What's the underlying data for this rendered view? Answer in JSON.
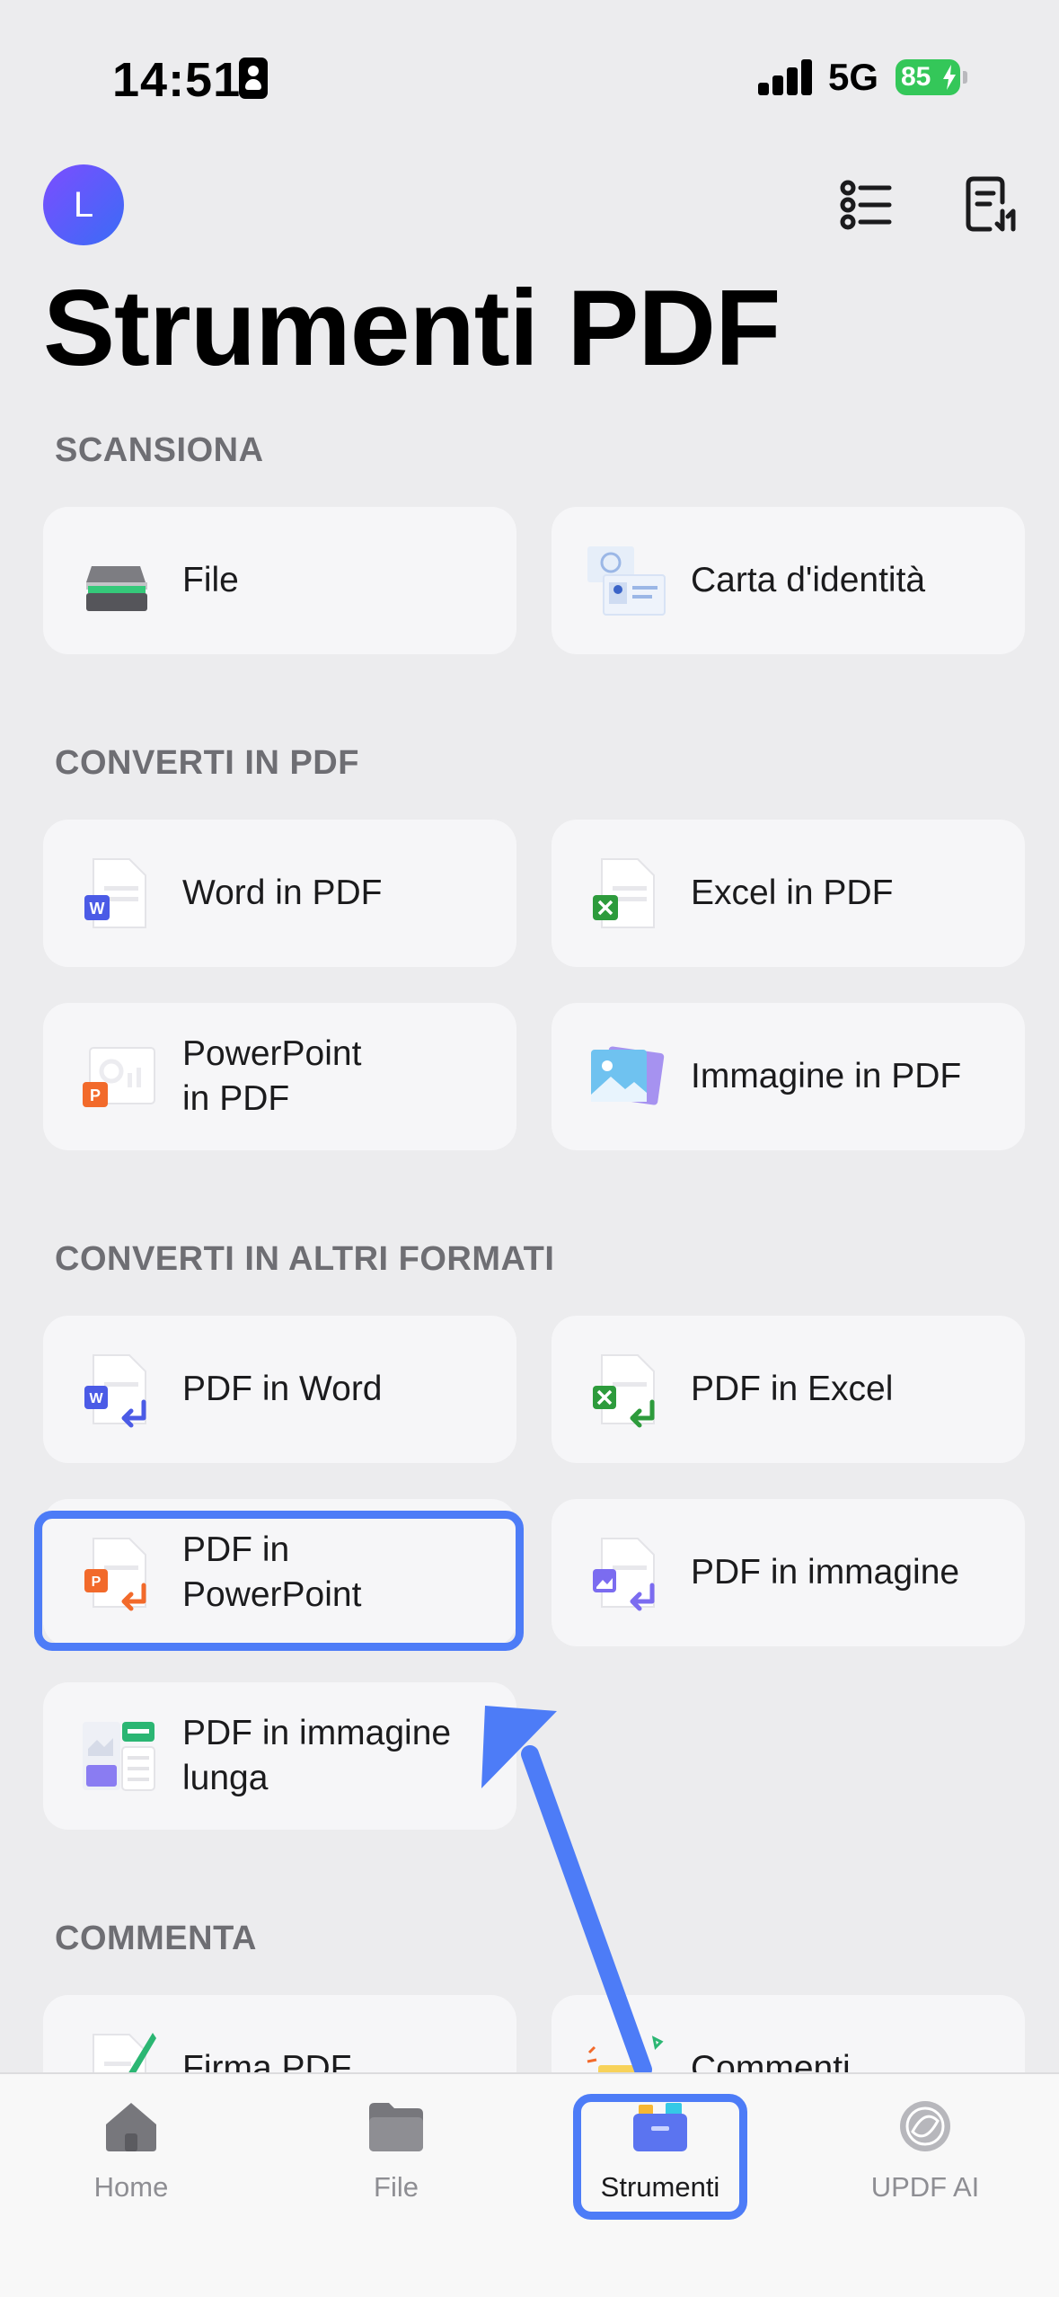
{
  "status_bar": {
    "time": "14:51",
    "network": "5G",
    "battery": "85"
  },
  "header": {
    "avatar_letter": "L",
    "title": "Strumenti PDF"
  },
  "sections": [
    {
      "title": "SCANSIONA",
      "items": [
        {
          "label": "File",
          "icon": "scanner-icon"
        },
        {
          "label": "Carta d'identità",
          "icon": "id-card-icon"
        }
      ]
    },
    {
      "title": "CONVERTI IN PDF",
      "items": [
        {
          "label": "Word in PDF",
          "icon": "word-doc-icon"
        },
        {
          "label": "Excel in PDF",
          "icon": "excel-doc-icon"
        },
        {
          "label": "PowerPoint\nin PDF",
          "icon": "powerpoint-doc-icon"
        },
        {
          "label": "Immagine in PDF",
          "icon": "image-stack-icon"
        }
      ]
    },
    {
      "title": "CONVERTI IN ALTRI FORMATI",
      "items": [
        {
          "label": "PDF in Word",
          "icon": "pdf-to-word-icon"
        },
        {
          "label": "PDF in Excel",
          "icon": "pdf-to-excel-icon"
        },
        {
          "label": "PDF in\nPowerPoint",
          "icon": "pdf-to-powerpoint-icon"
        },
        {
          "label": "PDF in immagine",
          "icon": "pdf-to-image-icon"
        },
        {
          "label": "PDF in immagine\nlunga",
          "icon": "pdf-to-long-image-icon"
        }
      ]
    },
    {
      "title": "COMMENTA",
      "items": [
        {
          "label": "Firma PDF",
          "icon": "signature-pen-icon"
        },
        {
          "label": "Commenti",
          "icon": "sticky-note-icon"
        }
      ]
    }
  ],
  "tabs": [
    {
      "label": "Home",
      "icon": "home-icon",
      "active": false
    },
    {
      "label": "File",
      "icon": "folder-icon",
      "active": false
    },
    {
      "label": "Strumenti",
      "icon": "toolbox-icon",
      "active": true
    },
    {
      "label": "UPDF AI",
      "icon": "ai-swirl-icon",
      "active": false
    }
  ],
  "colors": {
    "accent": "#4d7cf7",
    "battery": "#34c759",
    "background": "#ececee",
    "card": "#f6f6f8"
  }
}
